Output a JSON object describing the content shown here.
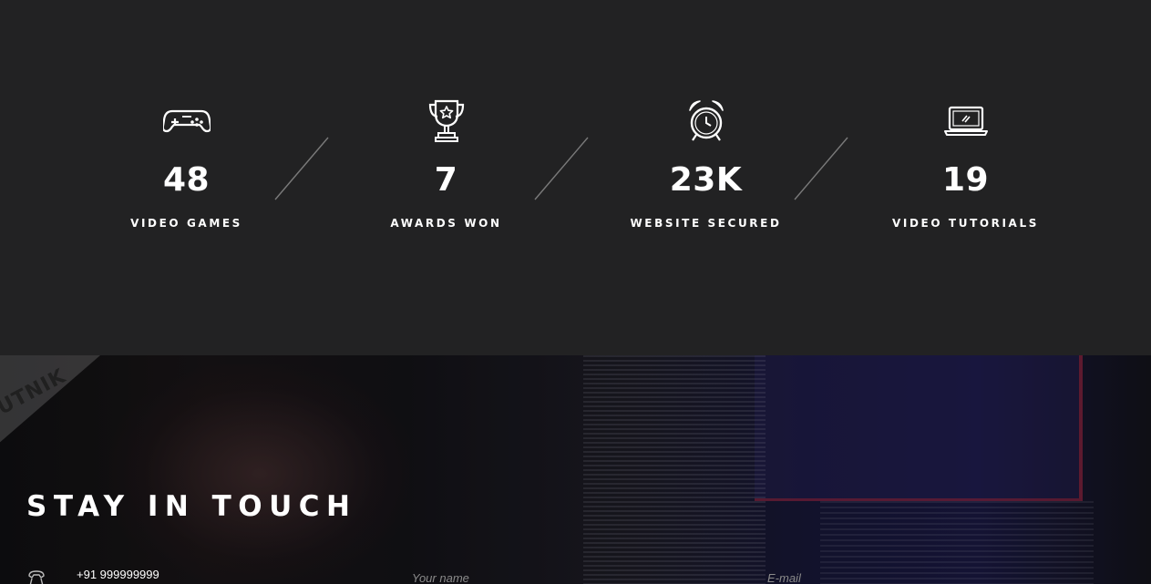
{
  "stats": [
    {
      "icon": "gamepad-icon",
      "value": "48",
      "label": "VIDEO GAMES"
    },
    {
      "icon": "trophy-icon",
      "value": "7",
      "label": "AWARDS WON"
    },
    {
      "icon": "alarm-clock-icon",
      "value": "23K",
      "label": "WEBSITE SECURED"
    },
    {
      "icon": "laptop-icon",
      "value": "19",
      "label": "VIDEO TUTORIALS"
    }
  ],
  "contact": {
    "title": "STAY IN TOUCH",
    "phone": "+91 999999999",
    "name_placeholder": "Your name",
    "email_placeholder": "E-mail"
  },
  "colors": {
    "background": "#222223",
    "text": "#ffffff",
    "divider": "#7a7a7a"
  }
}
